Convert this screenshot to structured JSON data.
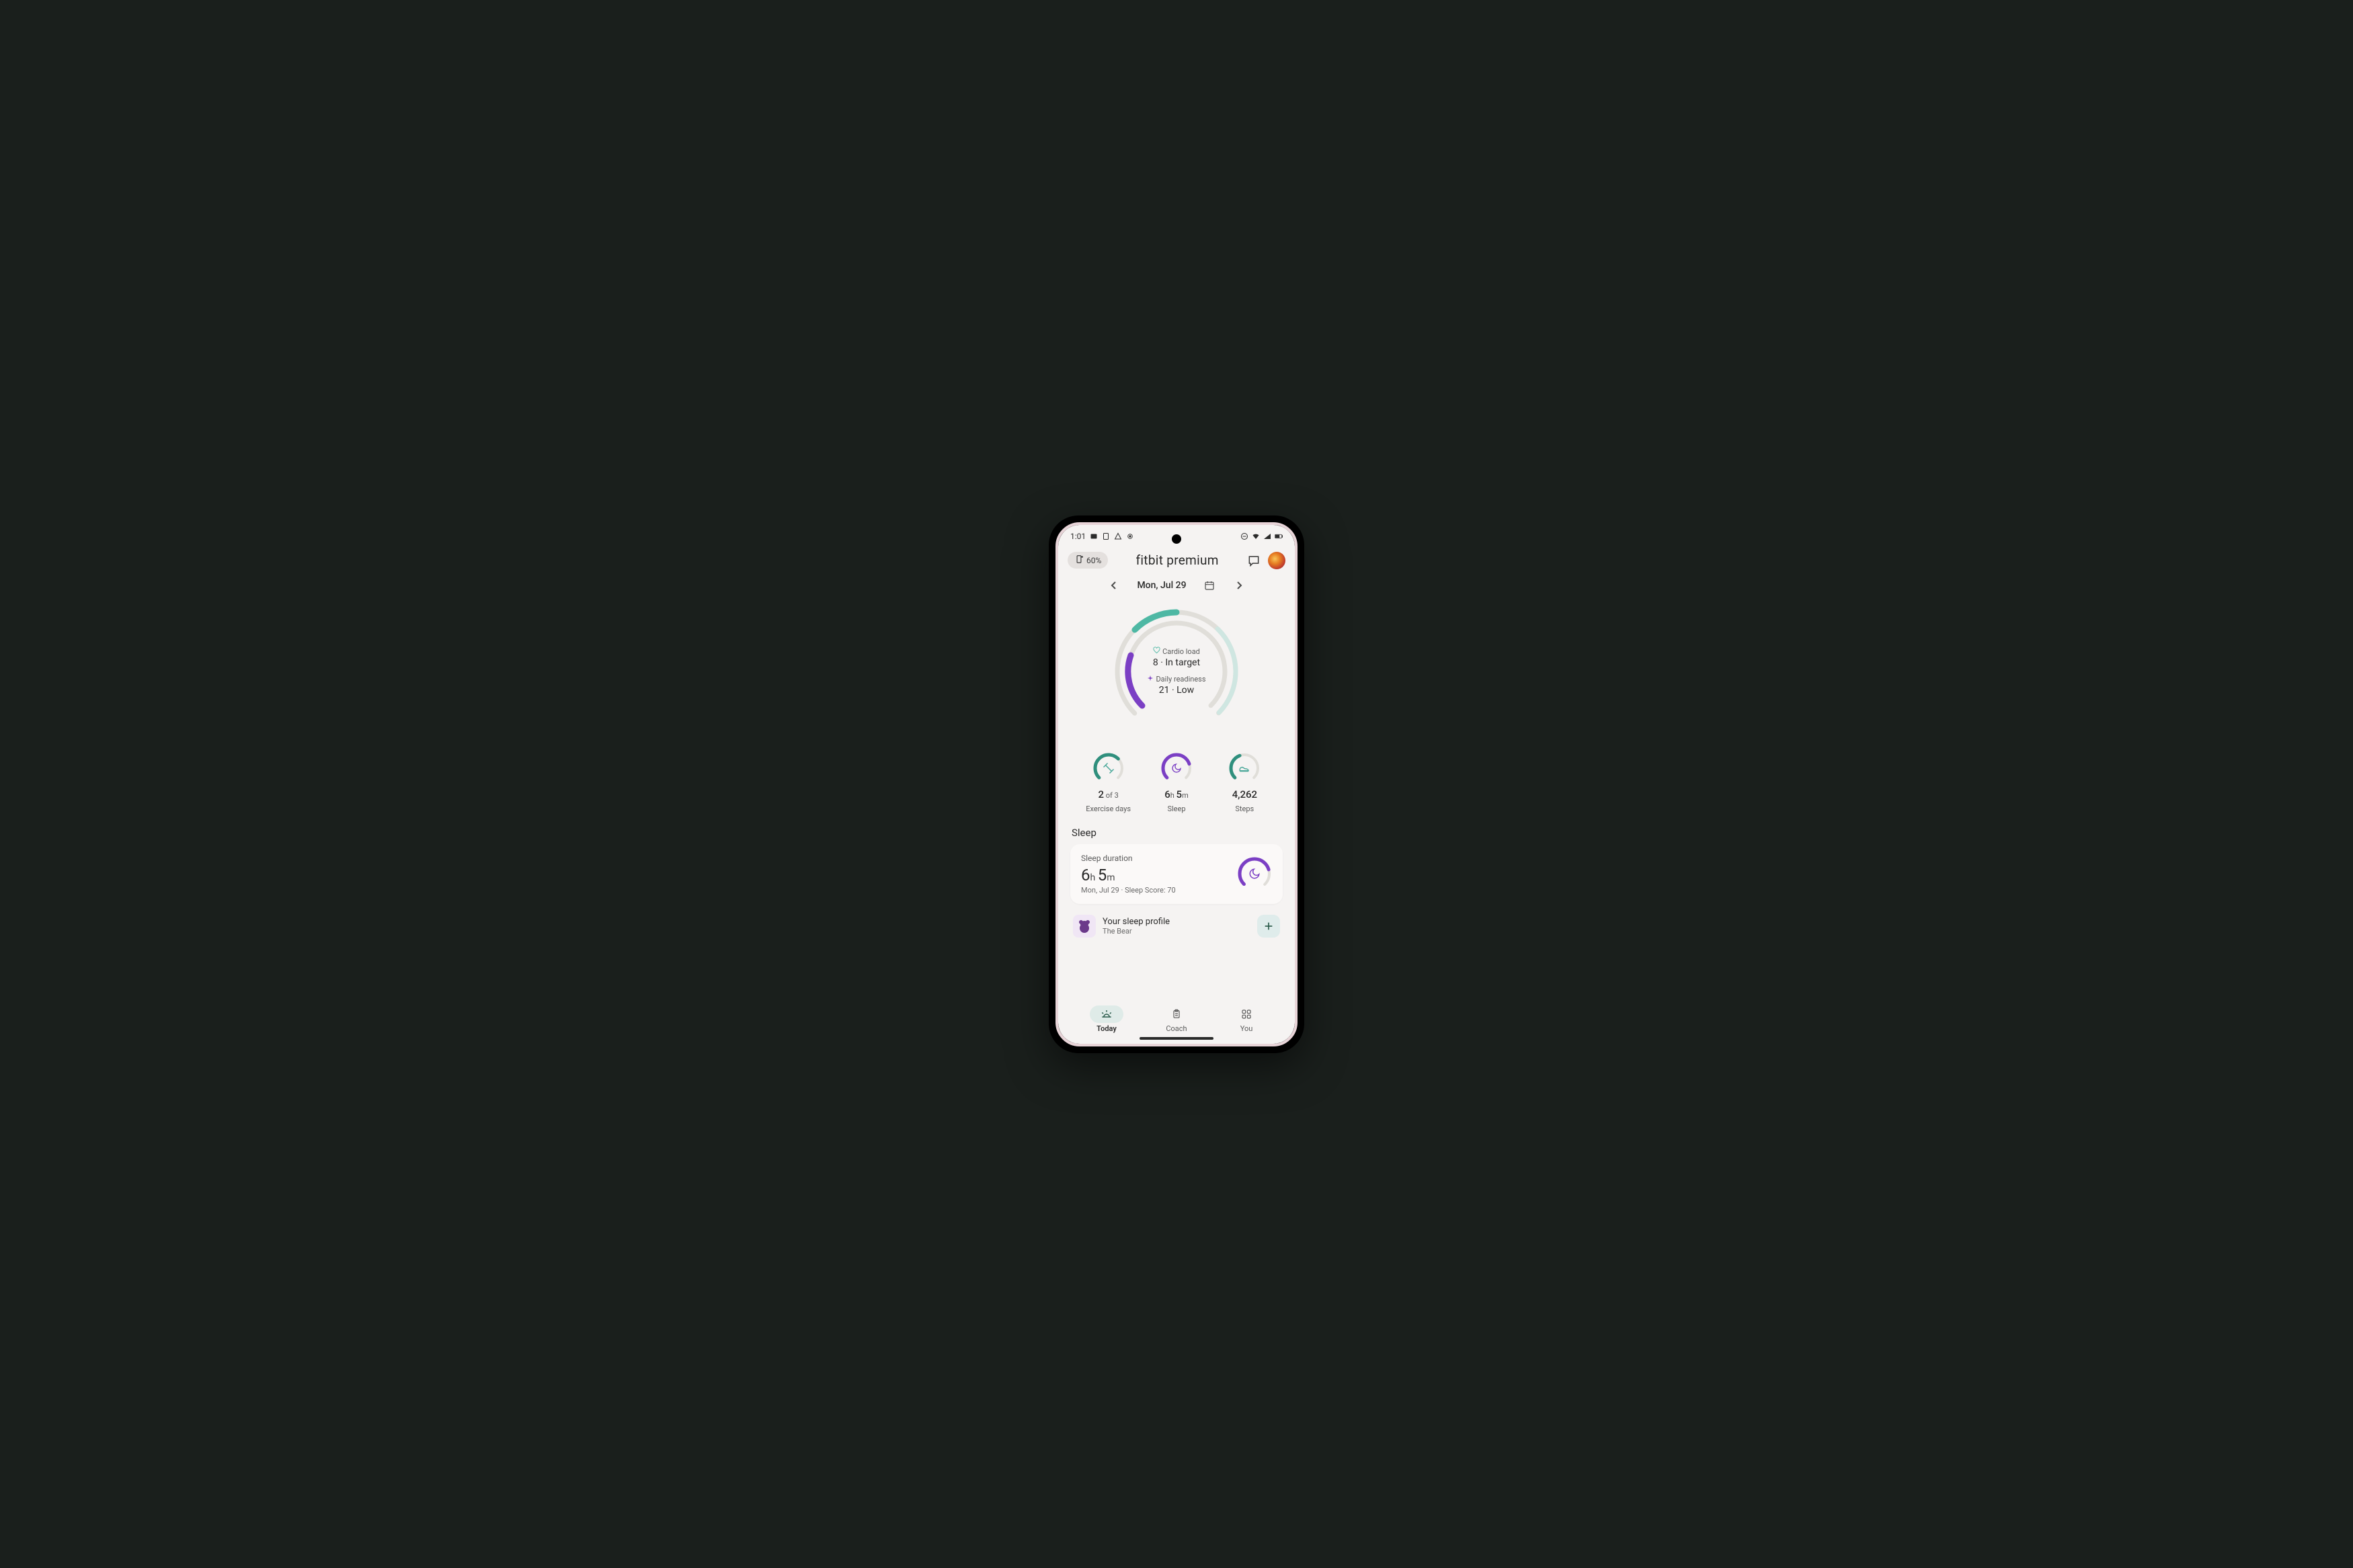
{
  "status_bar": {
    "time": "1:01"
  },
  "header": {
    "battery_percent": "60%",
    "title": "fitbit premium"
  },
  "date_nav": {
    "label": "Mon, Jul 29"
  },
  "main_gauge": {
    "cardio": {
      "label": "Cardio load",
      "value": "8 · In target"
    },
    "readiness": {
      "label": "Daily readiness",
      "value": "21 · Low"
    },
    "colors": {
      "teal": "#4eb8a4",
      "purple": "#7b3fc4",
      "track": "#e0ded9"
    }
  },
  "rings": {
    "exercise": {
      "value_main": "2",
      "value_of": " of 3",
      "caption": "Exercise days"
    },
    "sleep": {
      "value_h": "6",
      "value_hu": "h ",
      "value_m": "5",
      "value_mu": "m",
      "caption": "Sleep"
    },
    "steps": {
      "value": "4,262",
      "caption": "Steps"
    }
  },
  "sleep_section": {
    "title": "Sleep",
    "card": {
      "label": "Sleep duration",
      "hours": "6",
      "hours_unit": "h ",
      "mins": "5",
      "mins_unit": "m",
      "meta": "Mon, Jul 29 · Sleep Score: 70"
    },
    "profile": {
      "title": "Your sleep profile",
      "subtitle": "The Bear"
    }
  },
  "bottom_nav": {
    "today": "Today",
    "coach": "Coach",
    "you": "You"
  },
  "chart_data": {
    "type": "bar",
    "title": "Fitbit Today dashboard metrics",
    "categories": [
      "Cardio load",
      "Daily readiness",
      "Exercise days",
      "Sleep (h)",
      "Steps",
      "Sleep Score"
    ],
    "values": [
      8,
      21,
      2,
      6.08,
      4262,
      70
    ],
    "notes": {
      "cardio_load_status": "In target",
      "daily_readiness_status": "Low",
      "exercise_days_goal": 3,
      "sleep_duration_hm": "6h 5m",
      "date": "Mon, Jul 29"
    }
  }
}
